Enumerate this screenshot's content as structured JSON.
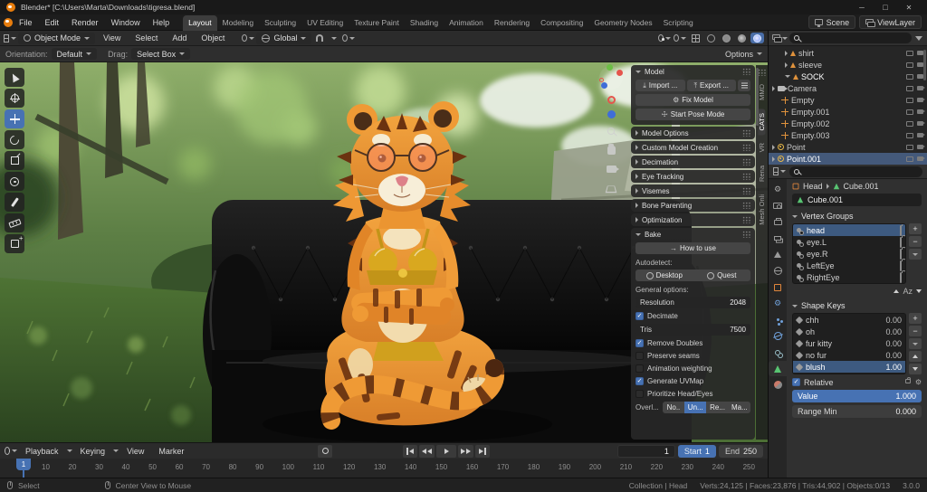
{
  "window": {
    "title": "Blender* [C:\\Users\\Marta\\Downloads\\tigresa.blend]"
  },
  "topbar": {
    "menus": [
      "File",
      "Edit",
      "Render",
      "Window",
      "Help"
    ],
    "workspaces": [
      "Layout",
      "Modeling",
      "Sculpting",
      "UV Editing",
      "Texture Paint",
      "Shading",
      "Animation",
      "Rendering",
      "Compositing",
      "Geometry Nodes",
      "Scripting"
    ],
    "scene_label": "Scene",
    "viewlayer_label": "ViewLayer"
  },
  "viewport": {
    "mode": "Object Mode",
    "menus": [
      "View",
      "Select",
      "Add",
      "Object"
    ],
    "orientation": "Global",
    "hdr2": {
      "orientation_label": "Orientation:",
      "orientation_value": "Default",
      "drag_label": "Drag:",
      "drag_value": "Select Box",
      "options_label": "Options"
    }
  },
  "cats": {
    "panel_title": "Model",
    "import_btn": "Import ...",
    "export_btn": "Export ...",
    "fix_btn": "Fix Model",
    "pose_btn": "Start Pose Mode",
    "collapsed_sections": [
      "Model Options",
      "Custom Model Creation",
      "Decimation",
      "Eye Tracking",
      "Visemes",
      "Bone Parenting",
      "Optimization"
    ],
    "bake": {
      "title": "Bake",
      "how_btn": "How to use",
      "autodetect_label": "Autodetect:",
      "desktop_btn": "Desktop",
      "quest_btn": "Quest",
      "general_label": "General options:",
      "resolution_label": "Resolution",
      "resolution_value": "2048",
      "decimate_label": "Decimate",
      "tris_label": "Tris",
      "tris_value": "7500",
      "remove_doubles_label": "Remove Doubles",
      "preserve_seams_label": "Preserve seams",
      "anim_weight_label": "Animation weighting",
      "gen_uvmap_label": "Generate UVMap",
      "prioritize_label": "Prioritize Head/Eyes",
      "overlap_label": "Overl...",
      "overlap_options": [
        "No..",
        "Un...",
        "Re...",
        "Ma..."
      ]
    },
    "tabs": [
      "MMD",
      "CATS",
      "VR",
      "Rena",
      "Mesh Onli"
    ]
  },
  "outliner": {
    "items": [
      {
        "name": "shirt"
      },
      {
        "name": "sleeve"
      },
      {
        "name": "SOCK"
      },
      {
        "name": "Camera"
      },
      {
        "name": "Empty"
      },
      {
        "name": "Empty.001"
      },
      {
        "name": "Empty.002"
      },
      {
        "name": "Empty.003"
      },
      {
        "name": "Point"
      },
      {
        "name": "Point.001"
      }
    ]
  },
  "properties": {
    "breadcrumb_object": "Head",
    "breadcrumb_data": "Cube.001",
    "name_field": "Cube.001",
    "vertex_groups_title": "Vertex Groups",
    "vertex_groups": [
      "head",
      "eye.L",
      "eye.R",
      "LeftEye",
      "RightEye"
    ],
    "sort_label": "Az",
    "shape_keys_title": "Shape Keys",
    "shape_keys": [
      {
        "name": "chh",
        "value": "0.00"
      },
      {
        "name": "oh",
        "value": "0.00"
      },
      {
        "name": "fur kitty",
        "value": "0.00"
      },
      {
        "name": "no fur",
        "value": "0.00"
      },
      {
        "name": "blush",
        "value": "1.00"
      }
    ],
    "relative_label": "Relative",
    "value_label": "Value",
    "value": "1.000",
    "range_min_label": "Range Min",
    "range_min_value": "0.000"
  },
  "timeline": {
    "menus": [
      "Playback",
      "Keying",
      "View",
      "Marker"
    ],
    "current_frame": "1",
    "frame_value": "1",
    "start_label": "Start",
    "start_value": "1",
    "end_label": "End",
    "end_value": "250",
    "ruler": [
      "10",
      "20",
      "30",
      "40",
      "50",
      "60",
      "70",
      "80",
      "90",
      "100",
      "110",
      "120",
      "130",
      "140",
      "150",
      "160",
      "170",
      "180",
      "190",
      "200",
      "210",
      "220",
      "230",
      "240",
      "250"
    ]
  },
  "statusbar": {
    "left": "Select",
    "middle": "Center View to Mouse",
    "collection": "Collection | Head",
    "stats": "Verts:24,125 | Faces:23,876 | Tris:44,902 | Objects:0/13",
    "version": "3.0.0"
  },
  "colors": {
    "accent": "#4772b3",
    "brand_orange": "#e87d0d"
  }
}
